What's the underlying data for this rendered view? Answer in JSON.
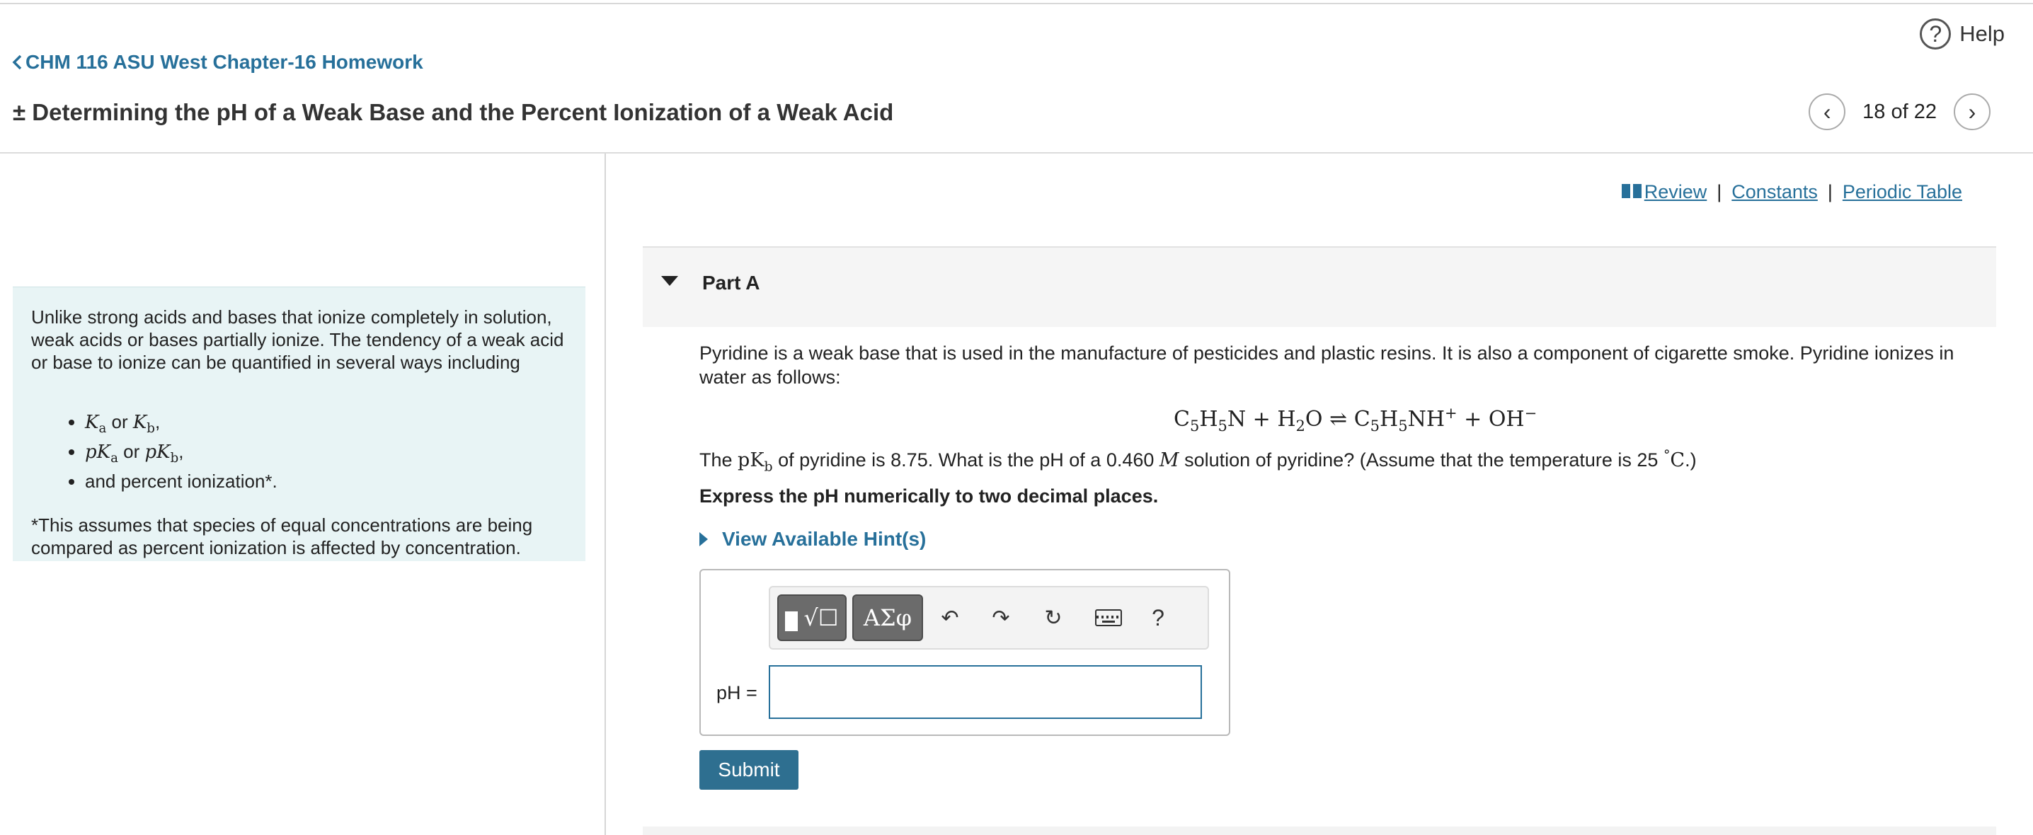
{
  "header": {
    "help_label": "Help",
    "help_icon": "?",
    "back_label": "CHM 116 ASU West Chapter-16 Homework",
    "title_prefix": "±",
    "title": "Determining the pH of a Weak Base and the Percent Ionization of a Weak Acid",
    "pager": {
      "prev_icon": "‹",
      "next_icon": "›",
      "label": "18 of 22"
    }
  },
  "intro": {
    "paragraph": "Unlike strong acids and bases that ionize completely in solution, weak acids or bases partially ionize. The tendency of a weak acid or base to ionize can be quantified in several ways including",
    "bullets": {
      "b1": {
        "a": "K",
        "a_sub": "a",
        "or": " or ",
        "b": "K",
        "b_sub": "b",
        "end": ","
      },
      "b2": {
        "a": "pK",
        "a_sub": "a",
        "or": " or ",
        "b": "pK",
        "b_sub": "b",
        "end": ","
      },
      "b3": "and percent ionization*."
    },
    "footnote": "*This assumes that species of equal concentrations are being compared as percent ionization is affected by concentration."
  },
  "links": {
    "review": "Review",
    "sep": "|",
    "constants": "Constants",
    "periodic_table": "Periodic Table"
  },
  "part": {
    "label": "Part A"
  },
  "question": {
    "text": "Pyridine is a weak base that is used in the manufacture of pesticides and plastic resins. It is also a component of cigarette smoke. Pyridine ionizes in water as follows:",
    "equation": {
      "c1": "C",
      "s1": "5",
      "h1": "H",
      "s2": "5",
      "n1": "N + H",
      "s3": "2",
      "o1": "O ⇌ C",
      "s4": "5",
      "h2": "H",
      "s5": "5",
      "nh": "NH",
      "plus": "+",
      "oh": " + OH",
      "minus": "−"
    },
    "pk": {
      "pre": "The ",
      "sym": "pK",
      "sub": "b",
      "mid": " of pyridine is 8.75. What is the pH of a 0.460 ",
      "unit": "M",
      "post": " solution of pyridine?   (Assume that the temperature is 25 ",
      "deg": "°",
      "C": "C",
      "end": ".)"
    },
    "instruction": "Express the pH numerically to two decimal places.",
    "hint_label": "View Available Hint(s)"
  },
  "toolbar": {
    "template_icon": "√☐",
    "greek_label": "ΑΣφ",
    "undo_icon": "↶",
    "redo_icon": "↷",
    "reset_icon": "↻",
    "help_icon": "?"
  },
  "answer": {
    "label": "pH =",
    "value": ""
  },
  "submit_label": "Submit"
}
